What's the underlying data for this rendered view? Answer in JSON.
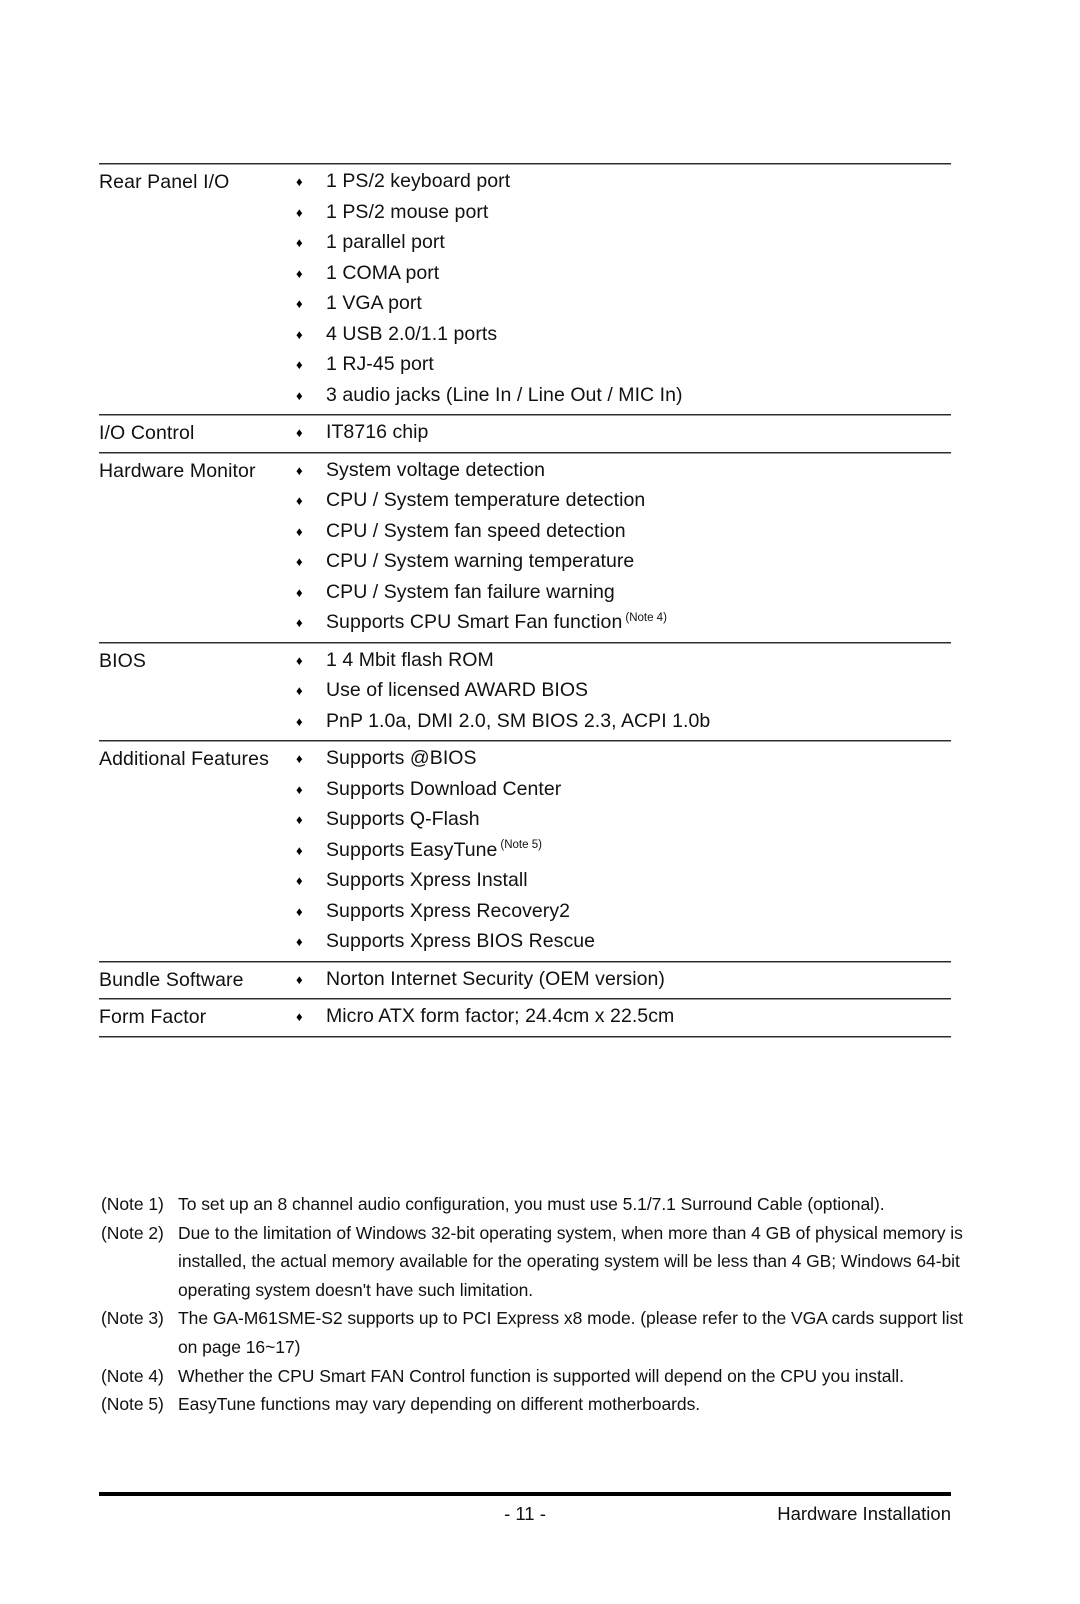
{
  "document": {
    "bullet_glyph": "♦"
  },
  "spec_table": {
    "rows": [
      {
        "label": "Rear Panel I/O",
        "items": [
          {
            "text": "1 PS/2 keyboard port"
          },
          {
            "text": "1 PS/2 mouse port"
          },
          {
            "text": "1 parallel port"
          },
          {
            "text": "1 COMA port"
          },
          {
            "text": "1 VGA port"
          },
          {
            "text": "4 USB 2.0/1.1 ports"
          },
          {
            "text": "1 RJ-45 port"
          },
          {
            "text": "3 audio jacks (Line In / Line Out / MIC In)"
          }
        ]
      },
      {
        "label": "I/O Control",
        "items": [
          {
            "text": "IT8716 chip"
          }
        ]
      },
      {
        "label": "Hardware Monitor",
        "items": [
          {
            "text": "System voltage detection"
          },
          {
            "text": "CPU / System temperature detection"
          },
          {
            "text": "CPU / System fan speed detection"
          },
          {
            "text": "CPU / System warning temperature"
          },
          {
            "text": "CPU / System fan failure warning"
          },
          {
            "text": "Supports CPU Smart Fan function",
            "sup": "(Note 4)"
          }
        ]
      },
      {
        "label": "BIOS",
        "items": [
          {
            "text": "1 4 Mbit flash ROM"
          },
          {
            "text": "Use of licensed AWARD BIOS"
          },
          {
            "text": "PnP 1.0a, DMI 2.0, SM BIOS 2.3, ACPI 1.0b"
          }
        ]
      },
      {
        "label": "Additional Features",
        "items": [
          {
            "text": "Supports @BIOS"
          },
          {
            "text": "Supports Download Center"
          },
          {
            "text": "Supports Q-Flash"
          },
          {
            "text": "Supports EasyTune",
            "sup": "(Note 5)"
          },
          {
            "text": "Supports Xpress Install"
          },
          {
            "text": "Supports Xpress Recovery2"
          },
          {
            "text": "Supports Xpress BIOS Rescue"
          }
        ]
      },
      {
        "label": "Bundle Software",
        "items": [
          {
            "text": "Norton Internet Security (OEM version)"
          }
        ]
      },
      {
        "label": "Form Factor",
        "items": [
          {
            "text": "Micro ATX form factor; 24.4cm x 22.5cm"
          }
        ]
      }
    ]
  },
  "notes": [
    {
      "label": "(Note 1)",
      "body": "To set up an 8 channel audio configuration, you must use 5.1/7.1 Surround Cable (optional)."
    },
    {
      "label": "(Note 2)",
      "body": "Due to the limitation of Windows 32-bit operating system, when more than 4 GB of physical memory is installed, the actual memory available for the operating system will be less than 4 GB; Windows 64-bit operating system doesn't have such limitation."
    },
    {
      "label": "(Note 3)",
      "body": "The GA-M61SME-S2 supports up to PCI Express x8 mode. (please refer to the VGA cards support list on page 16~17)"
    },
    {
      "label": "(Note 4)",
      "body": "Whether the CPU Smart FAN Control function is supported will depend on the CPU you install."
    },
    {
      "label": "(Note 5)",
      "body": "EasyTune functions may vary depending on different motherboards."
    }
  ],
  "footer": {
    "page_number": "- 11 -",
    "section_title": "Hardware Installation"
  }
}
